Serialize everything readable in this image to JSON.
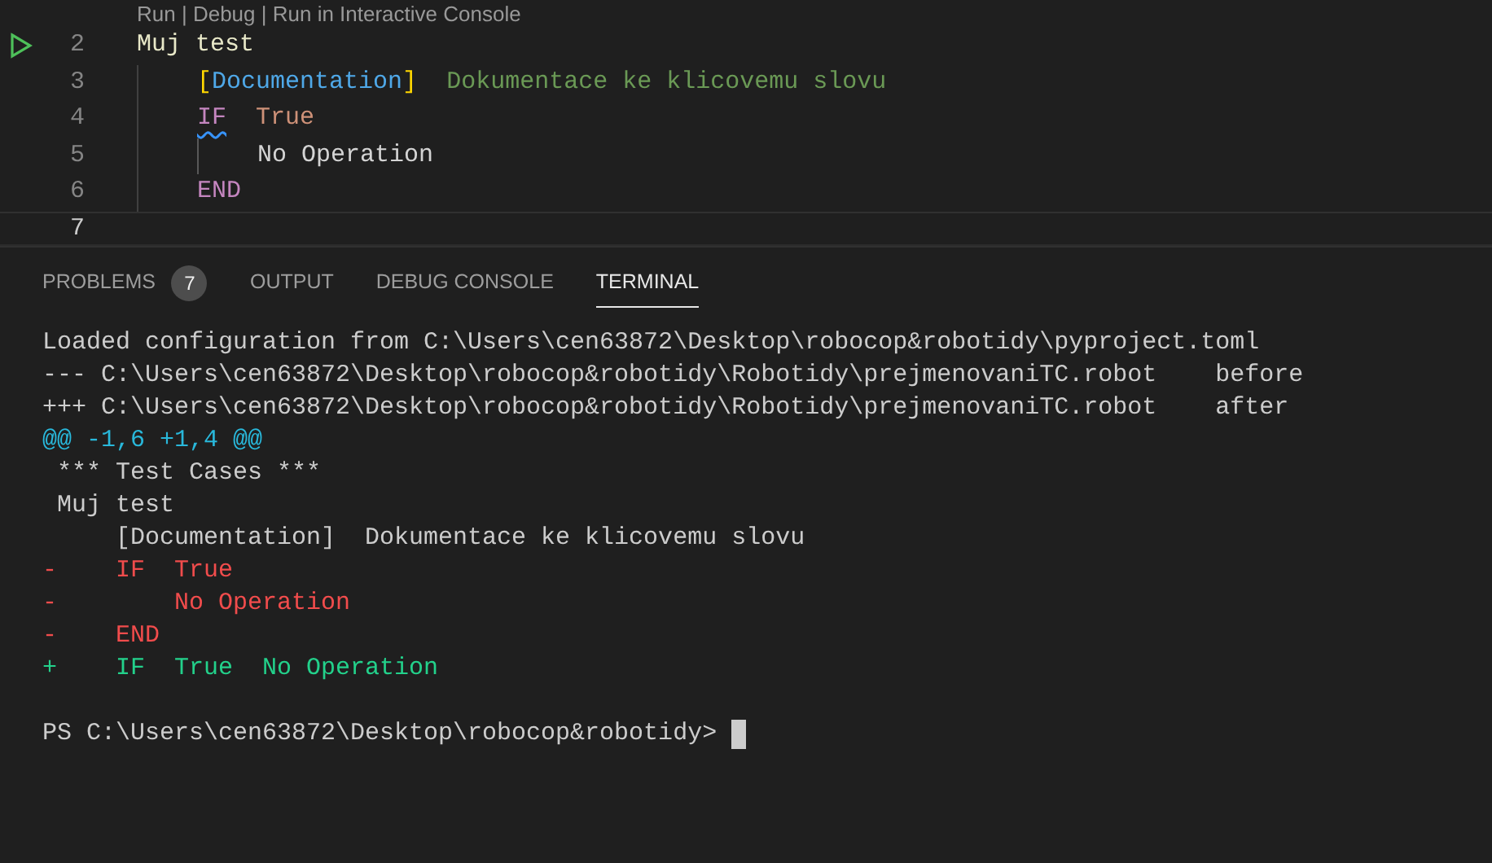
{
  "editor": {
    "codelens": "Run | Debug | Run in Interactive Console",
    "lines": [
      {
        "number": "2",
        "runnable": true,
        "current": false,
        "segments": [
          {
            "kind": "name",
            "text": "Muj test",
            "warning": false
          }
        ],
        "children": [
          {
            "number": "3",
            "runnable": false,
            "current": false,
            "segments": [
              {
                "kind": "bracket",
                "text": "[",
                "warning": false
              },
              {
                "kind": "setting",
                "text": "Documentation",
                "warning": false
              },
              {
                "kind": "bracket",
                "text": "]",
                "warning": false
              },
              {
                "kind": "doc",
                "text": "  Dokumentace ke klicovemu slovu",
                "warning": false
              }
            ]
          },
          {
            "number": "4",
            "runnable": false,
            "current": false,
            "segments": [
              {
                "kind": "keyword",
                "text": "IF",
                "warning": true
              },
              {
                "kind": "value",
                "text": "  True",
                "warning": false
              }
            ],
            "children": [
              {
                "number": "5",
                "runnable": false,
                "current": false,
                "segments": [
                  {
                    "kind": "plain",
                    "text": "No Operation",
                    "warning": false
                  }
                ]
              }
            ]
          },
          {
            "number": "6",
            "runnable": false,
            "current": false,
            "segments": [
              {
                "kind": "keyword",
                "text": "END",
                "warning": false
              }
            ]
          }
        ]
      },
      {
        "number": "7",
        "runnable": false,
        "current": true
      }
    ]
  },
  "panel": {
    "tabs": [
      {
        "label": "PROBLEMS",
        "badge": "7",
        "selected": false
      },
      {
        "label": "OUTPUT",
        "selected": false
      },
      {
        "label": "DEBUG CONSOLE",
        "selected": false
      },
      {
        "label": "TERMINAL",
        "selected": true
      }
    ],
    "terminal": {
      "lines": [
        {
          "kind": "plain",
          "text": "Loaded configuration from C:\\Users\\cen63872\\Desktop\\robocop&robotidy\\pyproject.toml"
        },
        {
          "kind": "plain",
          "text": "--- C:\\Users\\cen63872\\Desktop\\robocop&robotidy\\Robotidy\\prejmenovaniTC.robot    before"
        },
        {
          "kind": "plain",
          "text": "+++ C:\\Users\\cen63872\\Desktop\\robocop&robotidy\\Robotidy\\prejmenovaniTC.robot    after"
        },
        {
          "kind": "hunk",
          "text": "@@ -1,6 +1,4 @@"
        },
        {
          "kind": "plain",
          "text": " *** Test Cases ***"
        },
        {
          "kind": "plain",
          "text": " Muj test"
        },
        {
          "kind": "plain",
          "text": "     [Documentation]  Dokumentace ke klicovemu slovu"
        },
        {
          "kind": "removed",
          "text": "-    IF  True"
        },
        {
          "kind": "removed",
          "text": "-        No Operation"
        },
        {
          "kind": "removed",
          "text": "-    END"
        },
        {
          "kind": "added",
          "text": "+    IF  True  No Operation"
        },
        {
          "kind": "plain"
        }
      ],
      "prompt": "PS C:\\Users\\cen63872\\Desktop\\robocop&robotidy> "
    }
  }
}
